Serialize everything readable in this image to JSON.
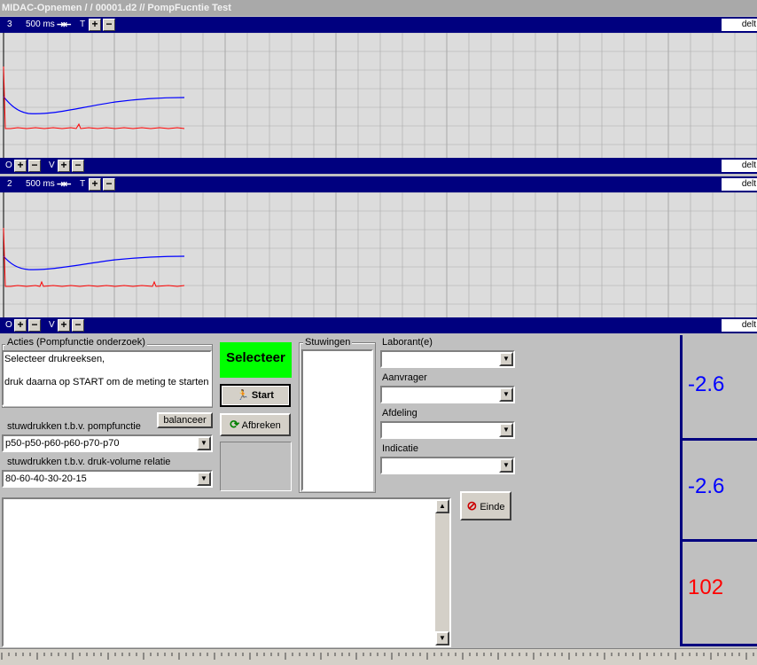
{
  "window": {
    "title": "MIDAC-Opnemen /  / 00001.d2 // PompFucntie Test"
  },
  "channels": [
    {
      "number": "3",
      "timebase": "500 ms",
      "t_label": "T",
      "o_label": "O",
      "v_label": "V",
      "delta_label": "delt"
    },
    {
      "number": "2",
      "timebase": "500 ms",
      "t_label": "T",
      "o_label": "O",
      "v_label": "V",
      "delta_label": "delt"
    }
  ],
  "trace_colors": {
    "blue": "#0000ff",
    "red": "#ff0000",
    "grid": "#a9a9a9",
    "background": "#dcdcdc"
  },
  "acties": {
    "title": "Acties (Pompfunctie onderzoek)",
    "line1": "Selecteer drukreeksen,",
    "line2": "druk daarna op START om de meting te starten"
  },
  "balanceer_label": "balanceer",
  "pomp": {
    "label": "stuwdrukken t.b.v. pompfunctie",
    "value": "p50-p50-p60-p60-p70-p70"
  },
  "druk": {
    "label": "stuwdrukken t.b.v.  druk-volume relatie",
    "value": "80-60-40-30-20-15"
  },
  "buttons": {
    "selecteer": "Selecteer",
    "selecteer_color": "#00ff00",
    "start": "Start",
    "afbreken": "Afbreken",
    "einde": "Einde"
  },
  "stuwingen": {
    "title": "Stuwingen"
  },
  "fields": {
    "laborant": "Laborant(e)",
    "aanvrager": "Aanvrager",
    "afdeling": "Afdeling",
    "indicatie": "Indicatie"
  },
  "readouts": [
    {
      "value": "-2.6",
      "color": "#0000ff"
    },
    {
      "value": "-2.6",
      "color": "#0000ff"
    },
    {
      "value": "102",
      "color": "#ff0000"
    }
  ]
}
